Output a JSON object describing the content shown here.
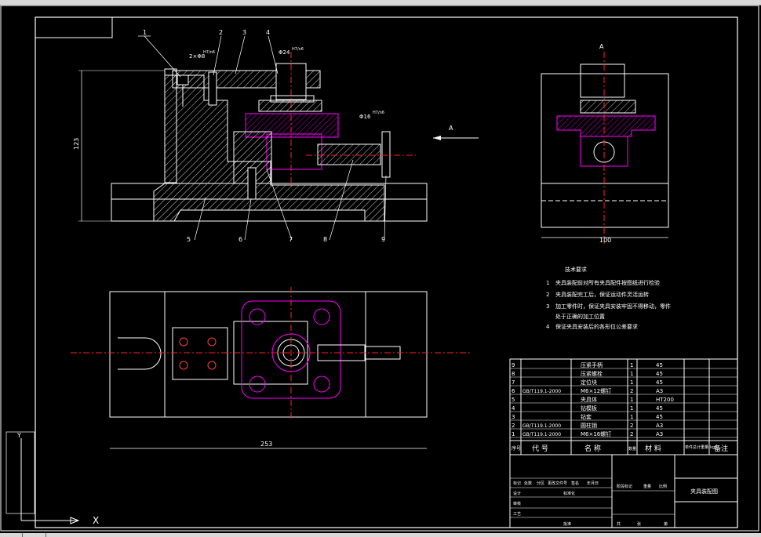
{
  "drawing": {
    "view_label": "A",
    "arrow_label": "A",
    "dimensions": {
      "height_main": "123",
      "width_side": "100",
      "width_plan": "253",
      "bore_left": "2×Φ8",
      "bore_left_tol": "H7/n6",
      "bore_mid": "Φ24",
      "bore_mid_tol": "H7/n6",
      "pin": "Φ16",
      "pin_tol": "H7/n6"
    },
    "balloons": [
      "1",
      "2",
      "3",
      "4",
      "5",
      "6",
      "7",
      "8",
      "9"
    ]
  },
  "technical_requirements": {
    "title": "技术要求",
    "items": [
      {
        "num": "1",
        "text": "夹具装配前对所有夹具配件按图纸进行检验"
      },
      {
        "num": "2",
        "text": "夹具装配完工后，保证运动件灵活运转"
      },
      {
        "num": "3",
        "text": "加工零件时，保证夹具安装牢固不得移动，零件"
      },
      {
        "num": "",
        "text": "处于正确的加工位置"
      },
      {
        "num": "4",
        "text": "保证夹具安装后的各形位公差要求"
      }
    ]
  },
  "bom": {
    "rows": [
      {
        "no": "9",
        "code": "",
        "name": "压紧手柄",
        "qty": "1",
        "mat": "45"
      },
      {
        "no": "8",
        "code": "",
        "name": "压紧螺栓",
        "qty": "1",
        "mat": "45"
      },
      {
        "no": "7",
        "code": "",
        "name": "定位块",
        "qty": "1",
        "mat": "45"
      },
      {
        "no": "6",
        "code": "GB/T119.1-2000",
        "name": "M6×12螺钉",
        "qty": "2",
        "mat": "A3"
      },
      {
        "no": "5",
        "code": "",
        "name": "夹具体",
        "qty": "1",
        "mat": "HT200"
      },
      {
        "no": "4",
        "code": "",
        "name": "钻模板",
        "qty": "1",
        "mat": "45"
      },
      {
        "no": "3",
        "code": "",
        "name": "钻套",
        "qty": "1",
        "mat": "45"
      },
      {
        "no": "2",
        "code": "GB/T119.1-2000",
        "name": "圆柱销",
        "qty": "2",
        "mat": "A3"
      },
      {
        "no": "1",
        "code": "GB/T119.1-2000",
        "name": "M6×16螺钉",
        "qty": "2",
        "mat": "A3"
      }
    ],
    "header": {
      "no": "序号",
      "code": "代 号",
      "name": "名 称",
      "qty": "数量",
      "mat": "材 料",
      "weight": "单件总计重量(kg)",
      "note": "备注"
    }
  },
  "title_block": {
    "drawing_name": "夹具装配图",
    "labels": [
      "标记",
      "处数",
      "分区",
      "更改文件号",
      "签名",
      "年月日"
    ],
    "design": "设计",
    "standard": "标准化",
    "check": "审核",
    "craft": "工艺",
    "approve": "批准",
    "stage": "阶段标记",
    "weight": "重量",
    "scale": "比例",
    "sheet_total": "共",
    "sheet": "张",
    "sheet_no": "第"
  },
  "ucs": {
    "x": "X",
    "y": "Y"
  },
  "colors": {
    "line": "#ffffff",
    "magenta": "#ff00ff",
    "center": "#ff2020",
    "bg": "#000000"
  }
}
